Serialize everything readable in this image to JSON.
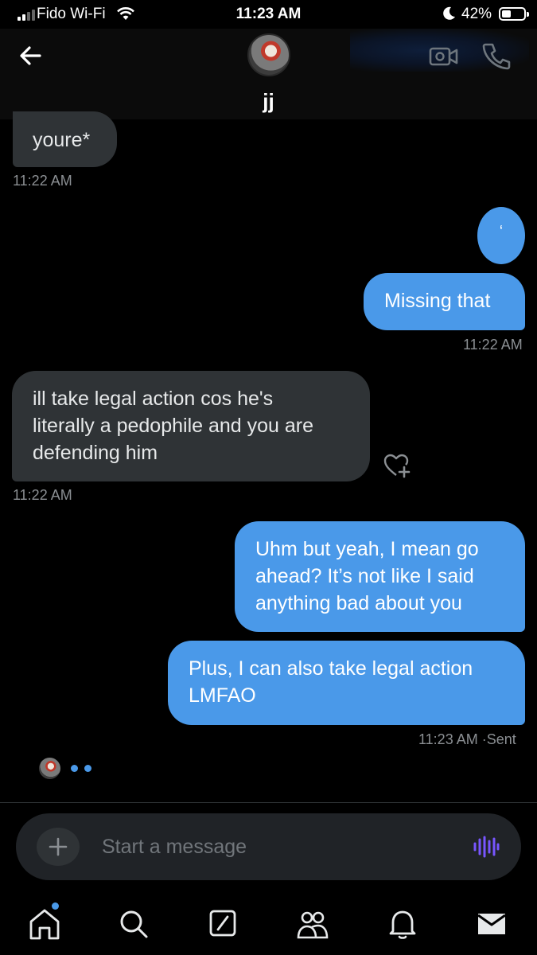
{
  "status_bar": {
    "carrier": "Fido Wi-Fi",
    "time": "11:23 AM",
    "battery_percent": "42%",
    "battery_level": 0.42
  },
  "header": {
    "contact_name": "jj",
    "icons": [
      "back-arrow-icon",
      "video-call-icon",
      "phone-call-icon"
    ]
  },
  "messages": [
    {
      "direction": "received",
      "text": "youre*",
      "time": "11:22 AM"
    },
    {
      "direction": "sent",
      "text": "‘",
      "time": ""
    },
    {
      "direction": "sent",
      "text": "Missing that",
      "time": "11:22 AM"
    },
    {
      "direction": "received",
      "text": "ill take legal action cos he's\nliterally a pedophile and you are\ndefending him",
      "time": "11:22 AM"
    },
    {
      "direction": "sent",
      "text": "Uhm but yeah, I mean go\nahead? It’s not like I said\nanything bad about you",
      "time": ""
    },
    {
      "direction": "sent",
      "text": "Plus, I can also take legal action\nLMFAO",
      "time": "11:23 AM",
      "status": "Sent"
    }
  ],
  "last_meta": "11:23 AM ·Sent",
  "composer": {
    "placeholder": "Start a message",
    "icons": [
      "plus-icon",
      "voice-message-icon"
    ]
  },
  "bottom_nav": {
    "items": [
      "home",
      "search",
      "compose",
      "communities",
      "notifications",
      "messages"
    ],
    "active": "messages",
    "accent_color": "#4a99e9",
    "unread_dot_on": "home"
  },
  "colors": {
    "sent_bubble": "#4a99e9",
    "received_bubble": "#2f3336",
    "background": "#000000",
    "voice_icon": "#7856ff"
  }
}
